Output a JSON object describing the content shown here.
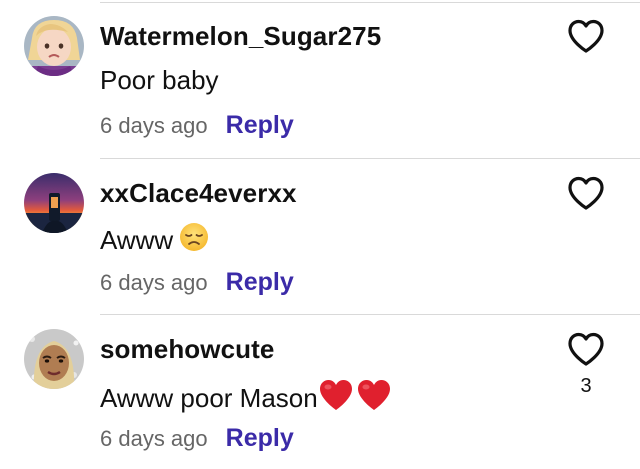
{
  "comments": [
    {
      "username": "Watermelon_Sugar275",
      "text": "Poor baby",
      "emoji": "",
      "timestamp": "6 days ago",
      "reply_label": "Reply",
      "like_count": "",
      "avatar_icon": "child-face-avatar"
    },
    {
      "username": "xxClace4everxx",
      "text": "Awww",
      "emoji": "disappointed-face-emoji",
      "timestamp": "6 days ago",
      "reply_label": "Reply",
      "like_count": "",
      "avatar_icon": "sunset-photo-avatar"
    },
    {
      "username": "somehowcute",
      "text": "Awww poor Mason",
      "emoji": "red-heart-emoji x2",
      "timestamp": "6 days ago",
      "reply_label": "Reply",
      "like_count": "3",
      "avatar_icon": "cartoon-face-avatar"
    }
  ],
  "colors": {
    "reply": "#3b2ba8",
    "timestamp": "#666666",
    "divider": "#d9d9d9",
    "heart_emoji": "#e0202e"
  }
}
